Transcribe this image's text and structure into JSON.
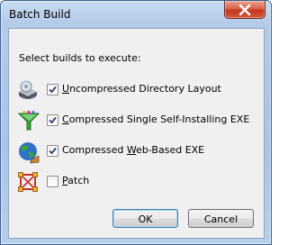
{
  "window": {
    "title": "Batch Build"
  },
  "dialog": {
    "prompt": "Select builds to execute:",
    "builds": [
      {
        "icon": "drive-icon",
        "accel": "U",
        "rest": "ncompressed Directory Layout",
        "checked": true
      },
      {
        "icon": "funnel-icon",
        "accel": "C",
        "rest": "ompressed Single Self-Installing EXE",
        "checked": true
      },
      {
        "icon": "globe-icon",
        "pre": "Compressed ",
        "accel": "W",
        "rest": "eb-Based EXE",
        "checked": true
      },
      {
        "icon": "patch-icon",
        "accel": "P",
        "rest": "atch",
        "checked": false
      }
    ],
    "ok_label": "OK",
    "cancel_label": "Cancel"
  }
}
